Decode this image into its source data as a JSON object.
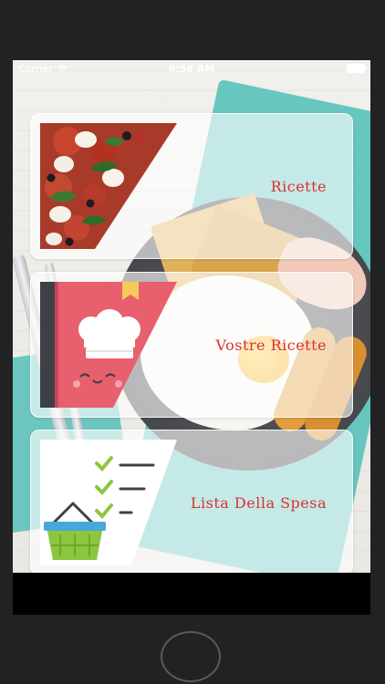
{
  "status_bar": {
    "carrier": "Carrier",
    "time": "6:58 AM"
  },
  "cards": [
    {
      "label": "Ricette",
      "image": "pizza-image"
    },
    {
      "label": "Vostre Ricette",
      "image": "recipe-book-icon"
    },
    {
      "label": "Lista Della Spesa",
      "image": "shopping-list-basket-icon"
    }
  ],
  "colors": {
    "label": "#d9322e",
    "cloth": "#5fc3bd",
    "card_bg": "rgba(255,255,255,0.62)"
  }
}
